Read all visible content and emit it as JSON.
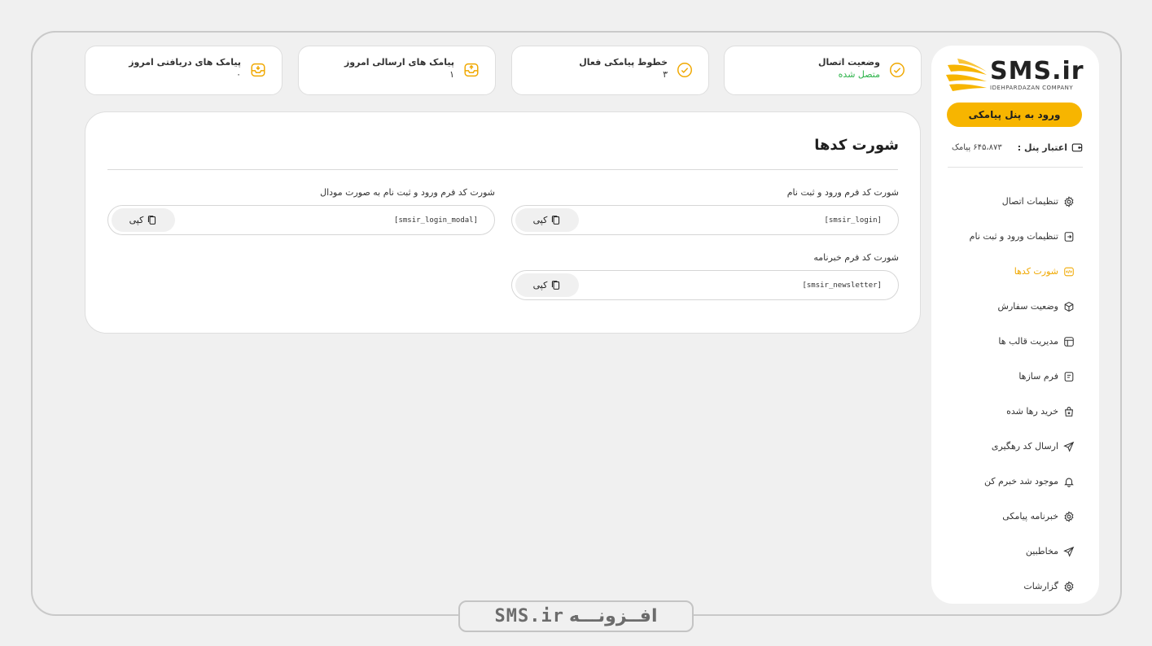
{
  "brand": {
    "logo_text": "SMS.ir",
    "logo_subtitle": "IDEHPARDAZAN COMPANY",
    "bottom_word": "افــزونـــه",
    "bottom_brand": "SMS.ir",
    "accent_color": "#f7b500"
  },
  "sidebar": {
    "panel_button": "ورود به پنل پیامکی",
    "credit_label": "اعتبار پنل :",
    "credit_value": "۶۴۵،۸۷۳ پیامک",
    "items": [
      {
        "label": "تنظیمات اتصال",
        "icon": "gear-icon"
      },
      {
        "label": "تنظیمات ورود و ثبت نام",
        "icon": "login-icon"
      },
      {
        "label": "شورت کدها",
        "icon": "code-icon",
        "active": true
      },
      {
        "label": "وضعیت سفارش",
        "icon": "box-icon"
      },
      {
        "label": "مدیریت قالب ها",
        "icon": "template-icon"
      },
      {
        "label": "فرم سازها",
        "icon": "form-icon"
      },
      {
        "label": "خرید رها شده",
        "icon": "bag-icon"
      },
      {
        "label": "ارسال کد رهگیری",
        "icon": "send-icon"
      },
      {
        "label": "موجود شد خبرم کن",
        "icon": "bell-icon"
      },
      {
        "label": "خبرنامه پیامکی",
        "icon": "gear-icon"
      },
      {
        "label": "مخاطبین",
        "icon": "send-icon"
      },
      {
        "label": "گزارشات",
        "icon": "gear-icon"
      }
    ]
  },
  "stats": {
    "connection": {
      "label": "وضعیت اتصال",
      "value": "متصل شده",
      "icon": "check-circle-icon"
    },
    "lines": {
      "label": "خطوط پیامکی فعال",
      "value": "۳",
      "icon": "check-circle-icon"
    },
    "sent": {
      "label": "پیامک های ارسالی امروز",
      "value": "۱",
      "icon": "outbox-icon"
    },
    "received": {
      "label": "پیامک های دریافتی امروز",
      "value": "۰",
      "icon": "inbox-icon"
    }
  },
  "main": {
    "title": "شورت کدها",
    "copy_label": "کپی",
    "shortcodes": [
      {
        "label": "شورت کد فرم ورود و ثبت نام",
        "code": "[smsir_login]"
      },
      {
        "label": "شورت کد فرم ورود و ثبت نام به صورت مودال",
        "code": "[smsir_login_modal]"
      },
      {
        "label": "شورت کد فرم خبرنامه",
        "code": "[smsir_newsletter]"
      }
    ]
  }
}
